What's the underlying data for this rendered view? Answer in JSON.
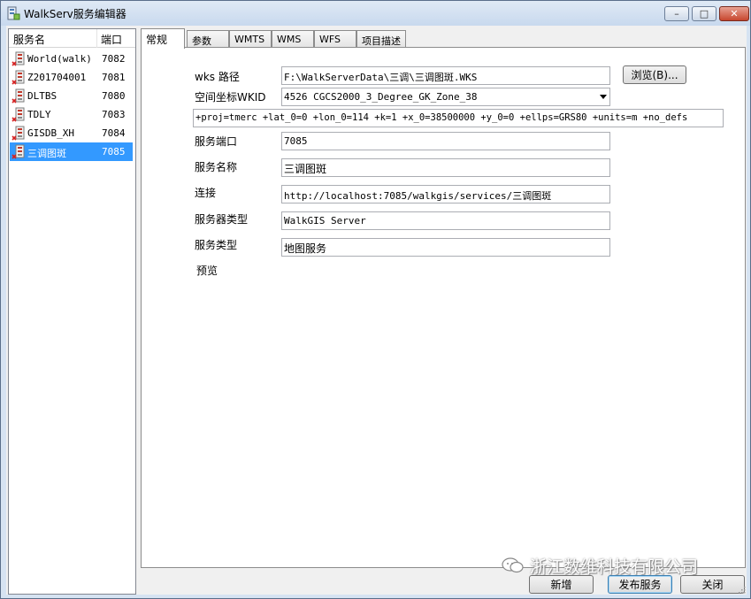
{
  "window": {
    "title": "WalkServ服务编辑器",
    "minimize_glyph": "–",
    "maximize_glyph": "□",
    "close_glyph": "✕"
  },
  "list": {
    "headers": {
      "name": "服务名",
      "port": "端口"
    },
    "items": [
      {
        "name": "World(walk)",
        "port": "7082"
      },
      {
        "name": "Z201704001",
        "port": "7081"
      },
      {
        "name": "DLTBS",
        "port": "7080"
      },
      {
        "name": "TDLY",
        "port": "7083"
      },
      {
        "name": "GISDB_XH",
        "port": "7084"
      },
      {
        "name": "三调图斑",
        "port": "7085",
        "selected": true
      }
    ]
  },
  "tabs": [
    {
      "label": "常规",
      "active": true
    },
    {
      "label": "参数"
    },
    {
      "label": "WMTS"
    },
    {
      "label": "WMS"
    },
    {
      "label": "WFS"
    },
    {
      "label": "项目描述"
    }
  ],
  "form": {
    "wks_path_label": "wks 路径",
    "wks_path_value": "F:\\WalkServerData\\三调\\三调图斑.WKS",
    "browse_label": "浏览(B)...",
    "wkid_label": "空间坐标WKID",
    "wkid_value": "4526 CGCS2000_3_Degree_GK_Zone_38",
    "proj_value": "+proj=tmerc +lat_0=0 +lon_0=114 +k=1 +x_0=38500000 +y_0=0 +ellps=GRS80 +units=m +no_defs",
    "port_label": "服务端口",
    "port_value": "7085",
    "name_label": "服务名称",
    "name_value": "三调图斑",
    "url_label": "连接",
    "url_value": "http://localhost:7085/walkgis/services/三调图斑",
    "server_type_label": "服务器类型",
    "server_type_value": "WalkGIS Server",
    "service_type_label": "服务类型",
    "service_type_value": "地图服务",
    "preview_label": "预览"
  },
  "buttons": {
    "new_label": "新增",
    "publish_label": "发布服务",
    "close_label": "关闭"
  },
  "watermark": {
    "text": "浙江数维科技有限公司"
  },
  "colors": {
    "selection": "#3399ff",
    "title_bar": "#c8d9ee",
    "close_button": "#c7462e",
    "face": "#f0f0f0"
  }
}
